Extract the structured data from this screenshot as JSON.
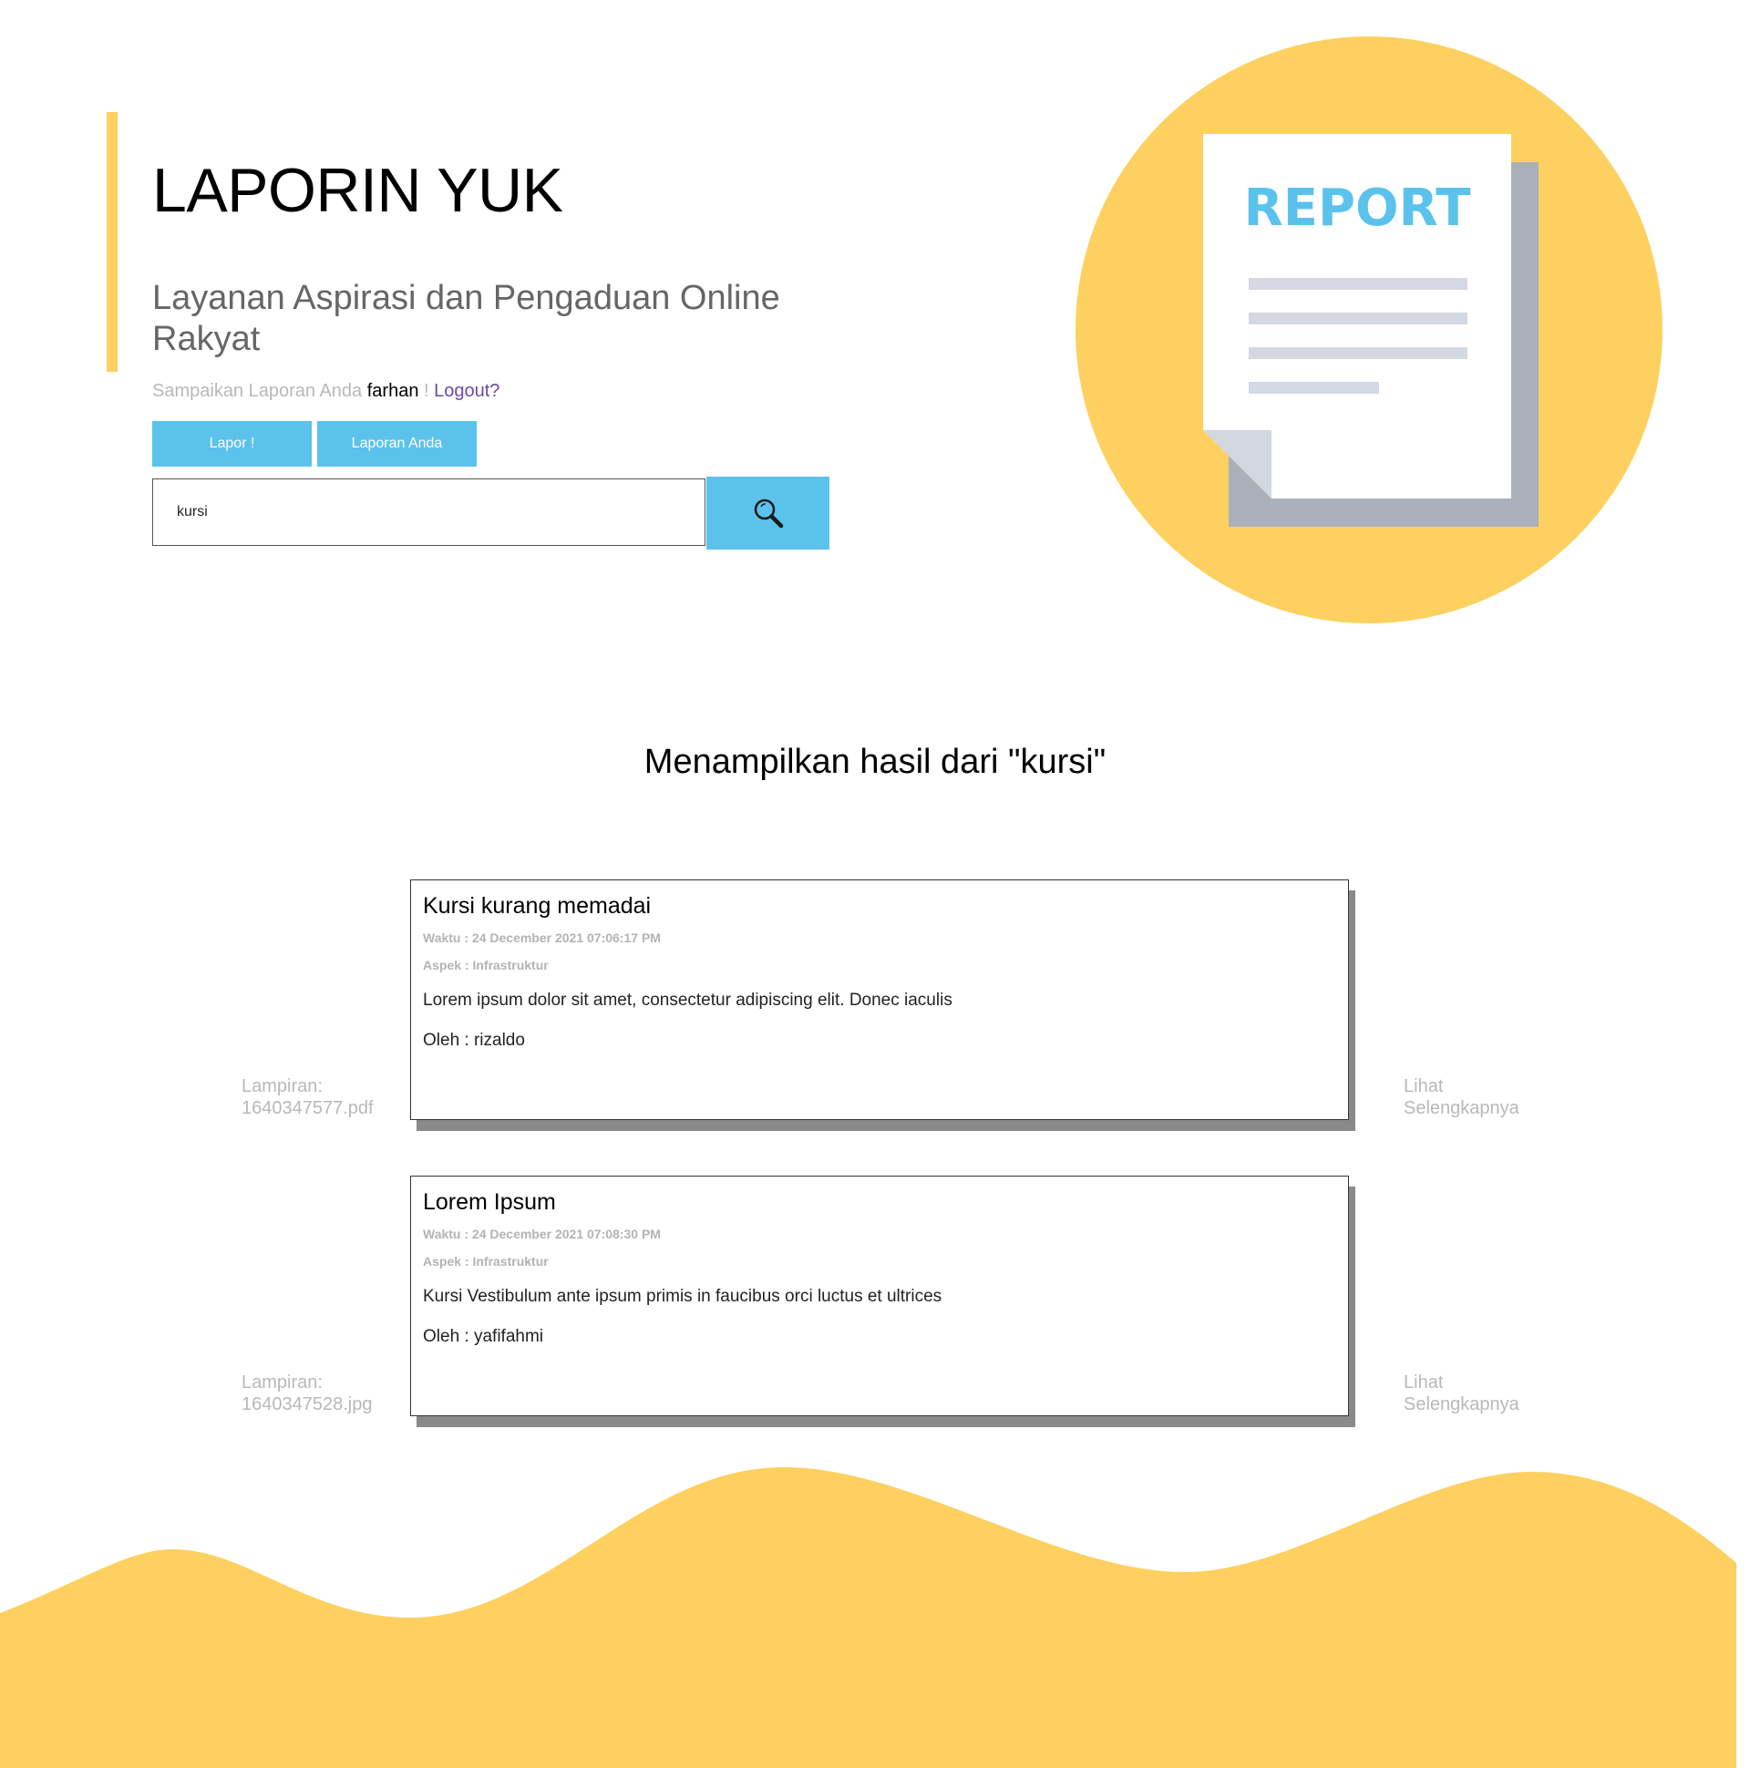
{
  "header": {
    "title": "LAPORIN YUK",
    "subtitle": "Layanan Aspirasi dan Pengaduan Online Rakyat",
    "greeting_prefix": "Sampaikan Laporan Anda ",
    "username": "farhan",
    "greeting_sep": " ! ",
    "logout_label": "Logout?"
  },
  "actions": {
    "lapor_label": "Lapor !",
    "laporan_anda_label": "Laporan Anda"
  },
  "search": {
    "value": "kursi",
    "button_icon": "search-icon"
  },
  "illustration": {
    "label": "REPORT",
    "circle_color": "#fdd05f",
    "text_color": "#5bc2eb"
  },
  "results": {
    "heading": "Menampilkan hasil dari \"kursi\"",
    "items": [
      {
        "title": "Kursi kurang memadai",
        "time": "Waktu : 24 December 2021 07:06:17 PM",
        "aspect": "Aspek : Infrastruktur",
        "body": "Lorem ipsum dolor sit amet, consectetur adipiscing elit. Donec iaculis",
        "author": "Oleh : rizaldo",
        "attachment_label": "Lampiran:",
        "attachment_file": "1640347577.pdf",
        "see_more_line1": "Lihat",
        "see_more_line2": "Selengkapnya"
      },
      {
        "title": "Lorem Ipsum",
        "time": "Waktu : 24 December 2021 07:08:30 PM",
        "aspect": "Aspek : Infrastruktur",
        "body": "Kursi Vestibulum ante ipsum primis in faucibus orci luctus et ultrices",
        "author": "Oleh : yafifahmi",
        "attachment_label": "Lampiran:",
        "attachment_file": "1640347528.jpg",
        "see_more_line1": "Lihat",
        "see_more_line2": "Selengkapnya"
      }
    ]
  },
  "colors": {
    "accent_yellow": "#fdd05f",
    "accent_blue": "#5bc2eb",
    "muted_text": "#b8b8b8"
  }
}
